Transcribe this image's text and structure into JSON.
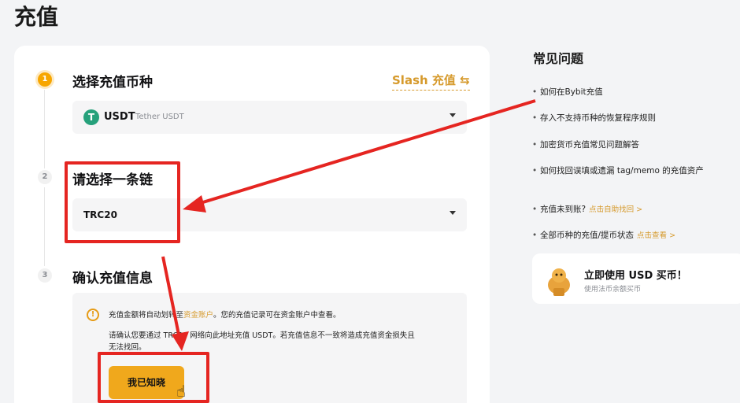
{
  "page": {
    "title": "充值"
  },
  "steps": [
    {
      "number": "1",
      "title": "选择充值币种"
    },
    {
      "number": "2",
      "title": "请选择一条链"
    },
    {
      "number": "3",
      "title": "确认充值信息"
    }
  ],
  "slash_link": "Slash 充值 ⇆",
  "coin_select": {
    "icon_glyph": "T",
    "symbol": "USDT",
    "full_name": "Tether USDT"
  },
  "chain_select": {
    "value": "TRC20"
  },
  "info": {
    "line1_prefix": "充值金额将自动划转至",
    "line1_link": "资金账户",
    "line1_suffix": "。您的充值记录可在资金账户中查看。",
    "line2": "请确认您要通过 TRC20 网络向此地址充值 USDT。若充值信息不一致将造成充值资金损失且",
    "line3": "无法找回。",
    "ack_button": "我已知晓"
  },
  "faq": {
    "title": "常见问题",
    "items": [
      "如何在Bybit充值",
      "存入不支持币种的恢复程序规则",
      "加密货币充值常见问题解答",
      "如何找回误填或遗漏 tag/memo 的充值资产"
    ],
    "extra": [
      {
        "text": "充值未到账?",
        "link": "点击自助找回 >"
      },
      {
        "text": "全部币种的充值/提币状态",
        "link": "点击查看 >"
      }
    ]
  },
  "buy_card": {
    "title": "立即使用 USD 买币！",
    "subtitle": "使用法币余额买币"
  },
  "colors": {
    "accent": "#f7a600",
    "annotation_red": "#e52521",
    "tether_green": "#26a17b"
  }
}
